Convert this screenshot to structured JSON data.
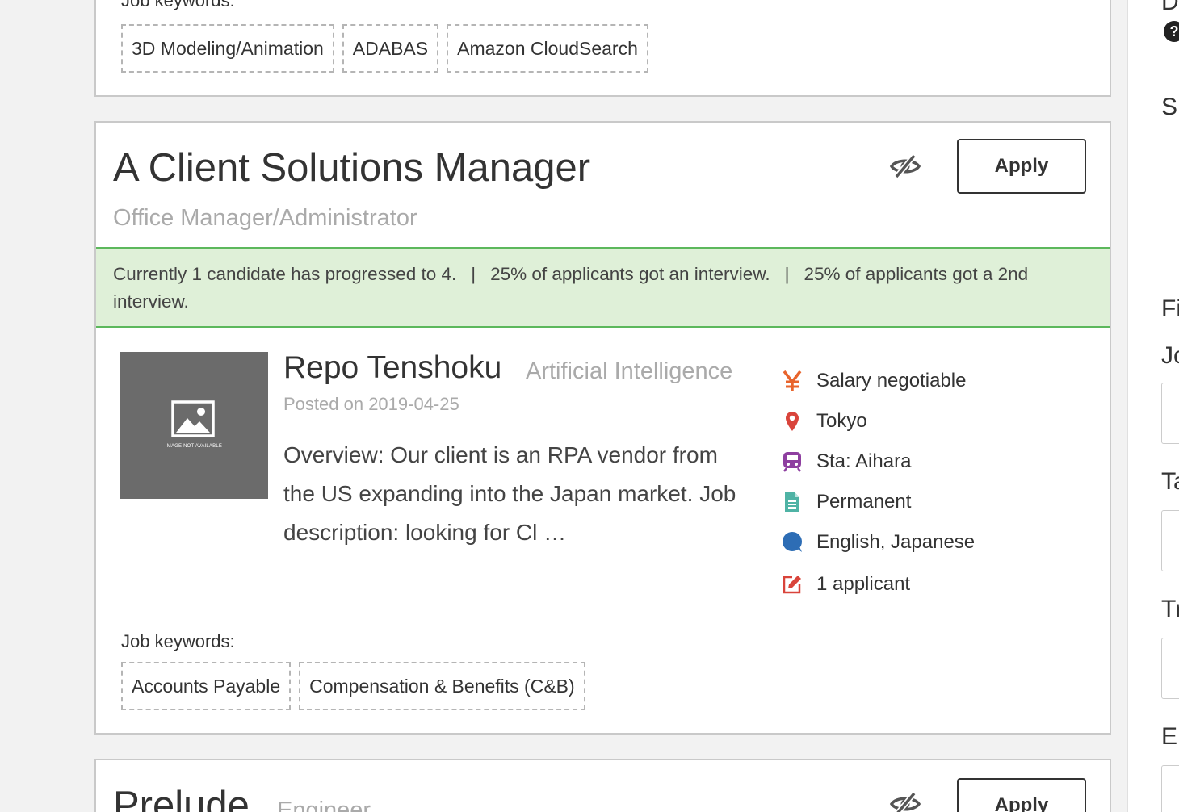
{
  "top_card": {
    "keywords_label": "Job keywords:",
    "keywords": [
      "3D Modeling/Animation",
      "ADABAS",
      "Amazon CloudSearch"
    ]
  },
  "job": {
    "title": "A Client Solutions Manager",
    "subtitle": "Office Manager/Administrator",
    "apply_label": "Apply",
    "stats": [
      "Currently 1 candidate has progressed to 4.",
      "25% of applicants got an interview.",
      "25% of applicants got a 2nd interview."
    ],
    "stats_separator": "|",
    "thumbnail_text": "IMAGE NOT AVAILABLE",
    "company": "Repo Tenshoku",
    "industry": "Artificial Intelligence",
    "posted": "Posted on 2019-04-25",
    "overview": "Overview: Our client is an RPA vendor from the US expanding into the Japan market. Job description: looking for Cl …",
    "details": [
      {
        "icon": "yen-icon",
        "text": "Salary negotiable",
        "color": "#e8642c"
      },
      {
        "icon": "map-pin-icon",
        "text": "Tokyo",
        "color": "#d9443b"
      },
      {
        "icon": "train-icon",
        "text": "Sta: Aihara",
        "color": "#8e3fa0"
      },
      {
        "icon": "document-icon",
        "text": "Permanent",
        "color": "#4fb3a5"
      },
      {
        "icon": "speech-bubble-icon",
        "text": "English, Japanese",
        "color": "#2d6db5"
      },
      {
        "icon": "edit-icon",
        "text": "1 applicant",
        "color": "#d9443b"
      }
    ],
    "keywords_label": "Job keywords:",
    "keywords": [
      "Accounts Payable",
      "Compensation & Benefits (C&B)"
    ]
  },
  "next_job": {
    "title": "Prelude",
    "subtitle": "Engineer",
    "apply_label": "Apply"
  },
  "sidebar": {
    "letters": [
      "D",
      "Sl",
      "Fi",
      "Jo",
      "Ta",
      "Tr",
      "En"
    ],
    "help_symbol": "?"
  }
}
